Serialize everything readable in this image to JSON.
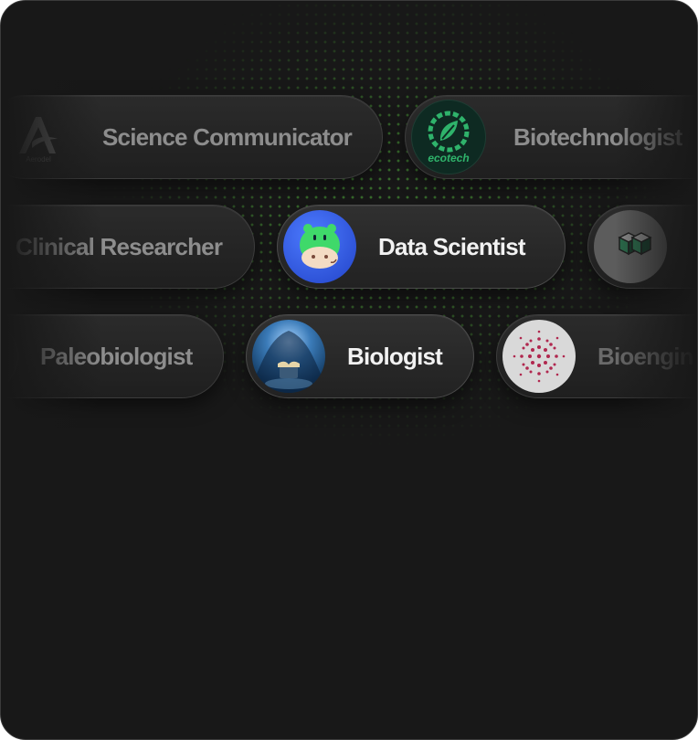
{
  "roles": {
    "science_communicator": {
      "label": "Science Communicator",
      "logo_text": "Aerodel"
    },
    "biotechnologist": {
      "label": "Biotechnologist",
      "logo_text": "ecotech"
    },
    "clinical_researcher": {
      "label": "Clinical Researcher"
    },
    "data_scientist": {
      "label": "Data Scientist"
    },
    "cube_partner": {
      "label": ""
    },
    "paleobiologist": {
      "label": "Paleobiologist"
    },
    "biologist": {
      "label": "Biologist"
    },
    "bioengineer": {
      "label": "Bioengin"
    }
  },
  "colors": {
    "card_background": "#181818",
    "dot_accent": "#60c846",
    "active_text": "#f2f2f2",
    "inactive_text": "#8d8d8d",
    "ecotech_green": "#2fb36b",
    "hippo_green": "#3fd96a",
    "avatar_blue": "#2f5fe8",
    "bioengineer_dots": "#b0284f"
  },
  "icons": [
    "aerodel-logo-icon",
    "ecotech-logo-icon",
    "hippo-mascot-icon",
    "cubes-icon",
    "cave-book-image",
    "radial-dots-icon"
  ]
}
